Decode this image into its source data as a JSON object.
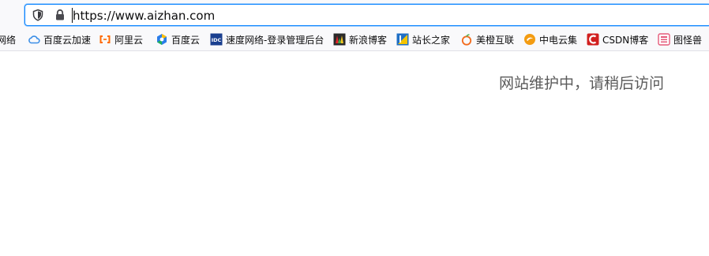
{
  "address_bar": {
    "url": "https://www.aizhan.com",
    "shield_icon": "tracking-protection-shield-icon",
    "lock_icon": "secure-lock-icon"
  },
  "bookmarks": [
    {
      "label": "网络",
      "icon": "none",
      "icon_color": "#000000"
    },
    {
      "label": "百度云加速",
      "icon": "cloud-icon",
      "icon_color": "#3b8ee6"
    },
    {
      "label": "阿里云",
      "icon": "aliyun-icon",
      "icon_color": "#ff6a00"
    },
    {
      "label": "百度云",
      "icon": "baidu-cloud-icon",
      "icon_color": "#2b7de9"
    },
    {
      "label": "速度网络-登录管理后台",
      "icon": "idc-icon",
      "icon_color": "#1a3f8f"
    },
    {
      "label": "新浪博客",
      "icon": "sina-blog-icon",
      "icon_color": "#e8242a"
    },
    {
      "label": "站长之家",
      "icon": "chinaz-icon",
      "icon_color": "#1f6fc5"
    },
    {
      "label": "美橙互联",
      "icon": "orange-fruit-icon",
      "icon_color": "#f26b1d"
    },
    {
      "label": "中电云集",
      "icon": "zhongdian-icon",
      "icon_color": "#f39c12"
    },
    {
      "label": "CSDN博客",
      "icon": "csdn-icon",
      "icon_color": "#d11f1f"
    },
    {
      "label": "图怪兽",
      "icon": "tuguaishou-icon",
      "icon_color": "#e55a7a"
    }
  ],
  "main": {
    "message": "网站维护中，请稍后访问"
  }
}
